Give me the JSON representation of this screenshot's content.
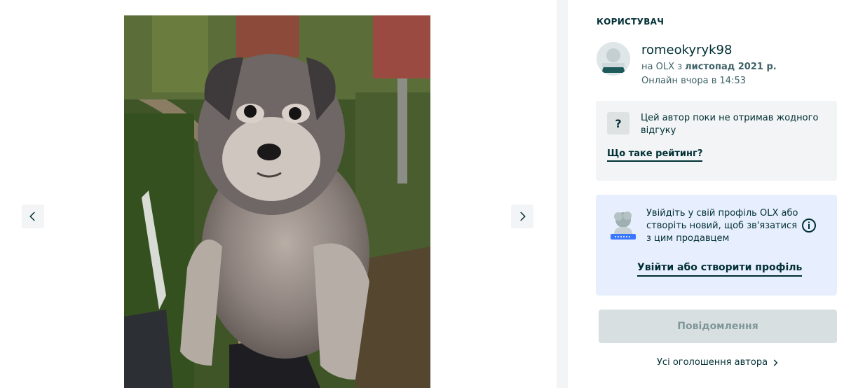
{
  "gallery": {
    "photo_alt": "puppy-photo",
    "prev_icon": "chevron-left-icon",
    "next_icon": "chevron-right-icon"
  },
  "seller": {
    "section_label": "КОРИСТУВАЧ",
    "username": "romeokyryk98",
    "member_prefix": "на OLX з ",
    "member_since": "листопад 2021 р.",
    "online_status": "Онлайн вчора в 14:53"
  },
  "rating": {
    "icon_text": "?",
    "text": "Цей автор поки не отримав жодного відгуку",
    "link": "Що таке рейтинг?"
  },
  "login_prompt": {
    "text": "Увійдіть у свій профіль OLX або створіть новий, щоб зв'язатися з цим продавцем",
    "link": "Увійти або створити профіль"
  },
  "actions": {
    "message_button": "Повідомлення",
    "all_ads_link": "Усі оголошення автора"
  },
  "colors": {
    "text_primary": "#002f34",
    "text_secondary": "#406367",
    "rating_bg": "#f2f4f5",
    "login_bg": "#e7eefd",
    "button_disabled_bg": "#d8dfe0",
    "button_disabled_text": "#7f9799"
  }
}
